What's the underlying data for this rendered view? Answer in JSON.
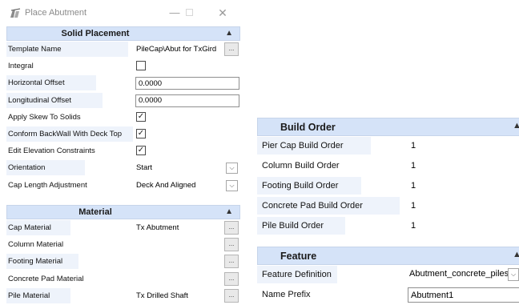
{
  "window": {
    "title": "Place Abutment",
    "icon": "bridge-abutment-icon",
    "minimize_glyph": "—",
    "close_glyph": "✕"
  },
  "solid_placement": {
    "header": "Solid Placement",
    "rows": {
      "template_name": {
        "label": "Template Name",
        "value": "PileCap\\Abut for TxGird",
        "button": "..."
      },
      "integral": {
        "label": "Integral",
        "checked": false
      },
      "horizontal_offset": {
        "label": "Horizontal Offset",
        "value": "0.0000"
      },
      "longitudinal_offset": {
        "label": "Longitudinal Offset",
        "value": "0.0000"
      },
      "apply_skew": {
        "label": "Apply Skew To Solids",
        "checked": true
      },
      "conform_backwall": {
        "label": "Conform BackWall With Deck Top",
        "checked": true
      },
      "edit_elevation": {
        "label": "Edit Elevation Constraints",
        "checked": true
      },
      "orientation": {
        "label": "Orientation",
        "value": "Start"
      },
      "cap_length": {
        "label": "Cap Length Adjustment",
        "value": "Deck And Aligned"
      }
    }
  },
  "material": {
    "header": "Material",
    "rows": {
      "cap": {
        "label": "Cap Material",
        "value": "Tx Abutment",
        "button": "..."
      },
      "column": {
        "label": "Column Material",
        "value": "",
        "button": "..."
      },
      "footing": {
        "label": "Footing Material",
        "value": "",
        "button": "..."
      },
      "concrete_pad": {
        "label": "Concrete Pad Material",
        "value": "",
        "button": "..."
      },
      "pile": {
        "label": "Pile Material",
        "value": "Tx Drilled Shaft",
        "button": "..."
      }
    }
  },
  "build_order": {
    "header": "Build Order",
    "rows": {
      "pier_cap": {
        "label": "Pier Cap Build Order",
        "value": "1"
      },
      "column": {
        "label": "Column Build Order",
        "value": "1"
      },
      "footing": {
        "label": "Footing Build Order",
        "value": "1"
      },
      "concrete_pad": {
        "label": "Concrete Pad Build Order",
        "value": "1"
      },
      "pile": {
        "label": "Pile Build Order",
        "value": "1"
      }
    }
  },
  "feature": {
    "header": "Feature",
    "rows": {
      "definition": {
        "label": "Feature Definition",
        "value": "Abutment_concrete_piles"
      },
      "name_prefix": {
        "label": "Name Prefix",
        "value": "Abutment1"
      }
    }
  },
  "glyphs": {
    "collapse": "▲",
    "dropdown": "⌵",
    "check": "✓"
  }
}
